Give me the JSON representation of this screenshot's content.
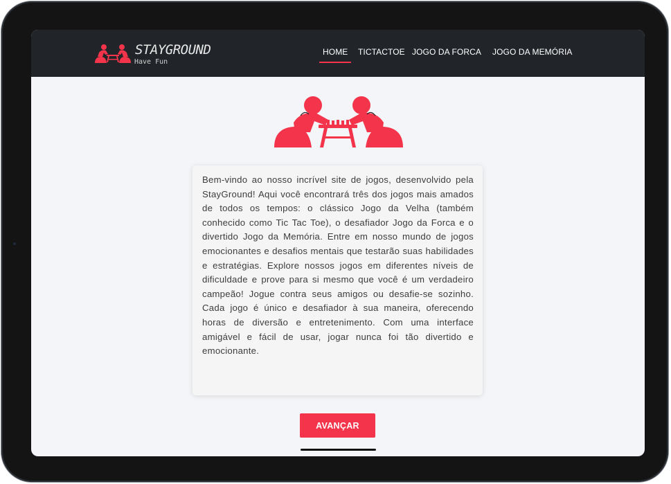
{
  "brand": {
    "title": "STAYGROUND",
    "tagline": "Have Fun"
  },
  "nav": {
    "items": [
      {
        "label": "HOME",
        "active": true
      },
      {
        "label": "TICTACTOE",
        "active": false
      },
      {
        "label": "JOGO DA FORCA",
        "active": false
      },
      {
        "label": "JOGO DA MEMÓRIA",
        "active": false
      }
    ]
  },
  "intro": {
    "text": "Bem-vindo ao nosso incrível site de jogos, desenvolvido pela StayGround! Aqui você encontrará três dos jogos mais amados de todos os tempos: o clássico Jogo da Velha (também conhecido como Tic Tac Toe), o desafiador Jogo da Forca e o divertido Jogo da Memória. Entre em nosso mundo de jogos emocionantes e desafios mentais que testarão suas habilidades e estratégias. Explore nossos jogos em diferentes níveis de dificuldade e prove para si mesmo que você é um verdadeiro campeão! Jogue contra seus amigos ou desafie-se sozinho. Cada jogo é único e desafiador à sua maneira, oferecendo horas de diversão e entretenimento. Com uma interface amigável e fácil de usar, jogar nunca foi tão divertido e emocionante."
  },
  "actions": {
    "next_label": "AVANÇAR"
  },
  "colors": {
    "accent": "#f3344a",
    "navbar": "#212529",
    "page_bg": "#f4f5f8",
    "card_bg": "#f5f5f5"
  },
  "icons": {
    "logo": "chess-players-icon",
    "hero": "chess-players-illustration"
  }
}
